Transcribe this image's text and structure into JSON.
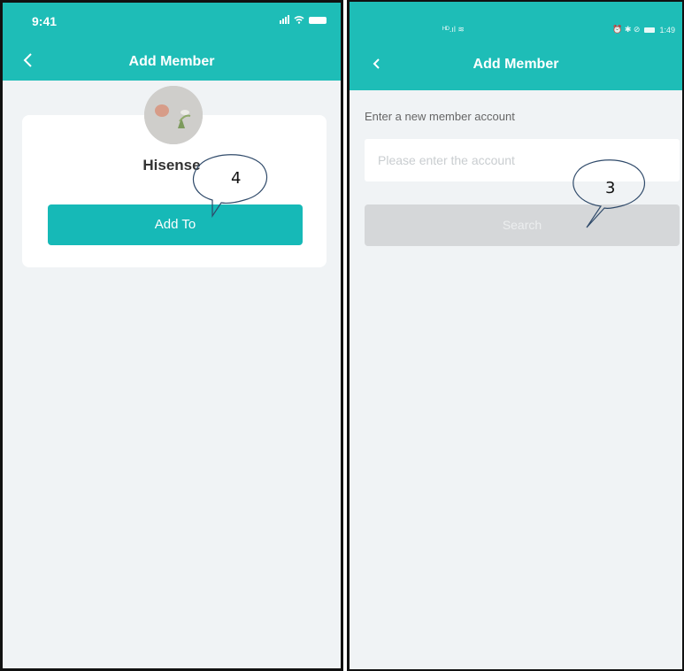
{
  "left_screen": {
    "status_time": "9:41",
    "title": "Add Member",
    "device_name": "Hisense",
    "add_button_label": "Add To"
  },
  "right_screen": {
    "status_left": "ᴴᴰ.ıl ≋",
    "status_right": "⏰ ✱ ⊘",
    "status_time": "1:49",
    "title": "Add Member",
    "field_label": "Enter a new member account",
    "input_value": "",
    "input_placeholder": "Please enter the account",
    "search_button_label": "Search"
  },
  "annotations": {
    "callout_left": "4",
    "callout_right": "3"
  },
  "colors": {
    "brand": "#1ebdb7",
    "button_teal": "#16b9b7",
    "button_disabled": "#d5d7d9",
    "background": "#f0f3f5"
  }
}
